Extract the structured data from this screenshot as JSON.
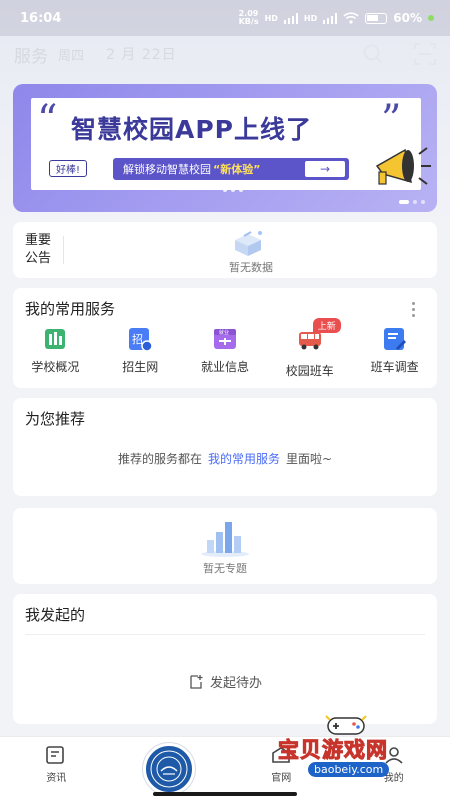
{
  "status_bar": {
    "time": "16:04",
    "network_speed": "2.09\nKB/s",
    "signal_1": "HD",
    "signal_2": "HD",
    "battery": "60%"
  },
  "header": {
    "title": "服务",
    "weekday": "周四",
    "date": "2 月 22日"
  },
  "banner": {
    "title": "智慧校园APP上线了",
    "tag": "好棒!",
    "cta_prefix": "解锁移动智慧校园",
    "cta_highlight": "新体验",
    "open_quote": "“",
    "close_quote": "”"
  },
  "notice": {
    "label_line1": "重要",
    "label_line2": "公告",
    "empty_text": "暂无数据"
  },
  "services": {
    "title": "我的常用服务",
    "items": [
      {
        "label": "学校概况",
        "icon": "school-building-icon",
        "color": "#3cb371"
      },
      {
        "label": "招生网",
        "icon": "enrollment-icon",
        "color": "#4a7cf7",
        "glyph": "招"
      },
      {
        "label": "就业信息",
        "icon": "employment-icon",
        "color": "#a66bea",
        "glyph": "就业"
      },
      {
        "label": "校园班车",
        "icon": "bus-icon",
        "color": "#e45b4b",
        "badge": "上新"
      },
      {
        "label": "班车调查",
        "icon": "survey-icon",
        "color": "#3d7bf0"
      }
    ]
  },
  "recommend": {
    "title": "为您推荐",
    "text_before": "推荐的服务都在",
    "link": "我的常用服务",
    "text_after": "里面啦~"
  },
  "topics": {
    "empty_text": "暂无专题"
  },
  "initiated": {
    "title": "我发起的",
    "action": "发起待办"
  },
  "bottom_nav": {
    "items": [
      {
        "label": "资讯",
        "icon": "news-icon"
      },
      {
        "label": "",
        "icon": "school-emblem-icon"
      },
      {
        "label": "官网",
        "icon": "website-icon"
      },
      {
        "label": "我的",
        "icon": "profile-icon"
      }
    ]
  },
  "watermark": {
    "text": "宝贝游戏网",
    "url": "baobeiy.com"
  },
  "colors": {
    "accent": "#4a6cf7",
    "banner_purple": "#8f87ea",
    "new_badge": "#ea4e4e"
  }
}
